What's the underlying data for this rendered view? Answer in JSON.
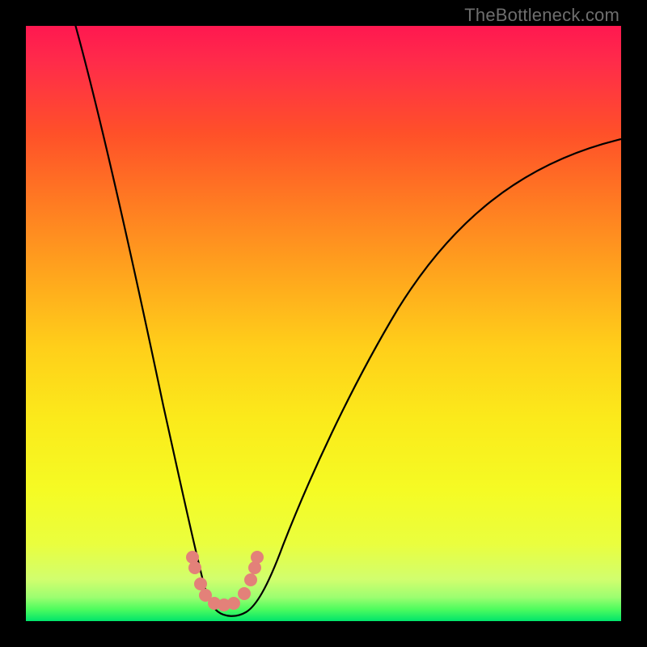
{
  "watermark": "TheBottleneck.com",
  "colors": {
    "frame": "#000000",
    "curve": "#000000",
    "marker": "#e38179",
    "green_band_top": "#c6fe88",
    "green_band_mid": "#52fc5c",
    "green_deep": "#00e46b"
  },
  "chart_data": {
    "type": "line",
    "title": "",
    "xlabel": "",
    "ylabel": "",
    "xlim": [
      0,
      100
    ],
    "ylim": [
      0,
      100
    ],
    "grid": false,
    "background": "rainbow-gradient (red→orange→yellow→green top-to-bottom)",
    "series": [
      {
        "name": "bottleneck-curve",
        "x": [
          0,
          4,
          8,
          12,
          16,
          20,
          24,
          28,
          30.5,
          33,
          36,
          40,
          45,
          50,
          56,
          62,
          70,
          80,
          90,
          100
        ],
        "y": [
          110,
          96,
          80,
          64,
          48,
          33,
          20,
          10,
          3,
          0.5,
          0.5,
          3,
          10,
          20,
          31,
          42,
          53,
          65,
          74,
          80
        ],
        "note": "y is percent height from bottom (0 = bottom). Curve is a sharp V with minimum near x≈33, left arm exits the top edge."
      }
    ],
    "markers": {
      "name": "highlighted-points",
      "x": [
        27.8,
        28.2,
        29.3,
        31,
        33,
        35,
        36.8,
        38.1,
        38.6
      ],
      "y": [
        10,
        8.2,
        6,
        3.7,
        3.2,
        3.5,
        5.2,
        7.5,
        9.5
      ],
      "style": "small salmon dots clustered around the valley"
    },
    "green_band": {
      "y_range": [
        0,
        5.5
      ],
      "note": "narrow horizontal band at the very bottom fading yellow→green"
    }
  }
}
